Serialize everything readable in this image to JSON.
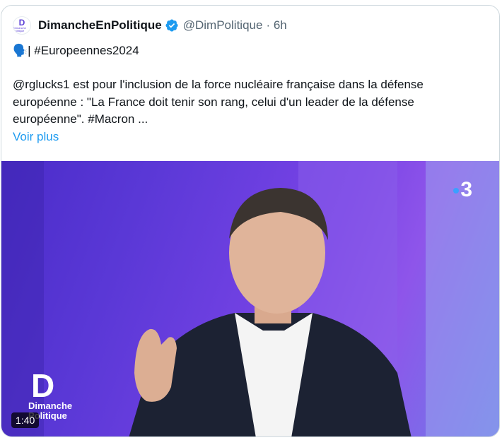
{
  "author": {
    "name": "DimancheEnPolitique",
    "handle": "@DimPolitique",
    "time": "· 6h",
    "avatar_text_top": "D",
    "avatar_text_bottom": "Dimanche Politique",
    "verified_icon": "verified-badge-icon"
  },
  "tweet": {
    "hashtag_line": "| #Europeennes2024",
    "speaker_icon": "🗣️",
    "line1": "@rglucks1 est pour l'inclusion de la force nucléaire française dans la défense",
    "line2": "européenne : \"La France doit tenir son rang, celui d'un leader de la défense",
    "line3": "européenne\". #Macron ...",
    "more_link": "Voir plus"
  },
  "media": {
    "channel": "3",
    "watermark_line1": "Dimanche",
    "watermark_line2": "Politique",
    "duration": "1:40"
  },
  "colors": {
    "accent": "#1d9bf0",
    "secondary_text": "#536471",
    "border": "#cfd9de"
  }
}
